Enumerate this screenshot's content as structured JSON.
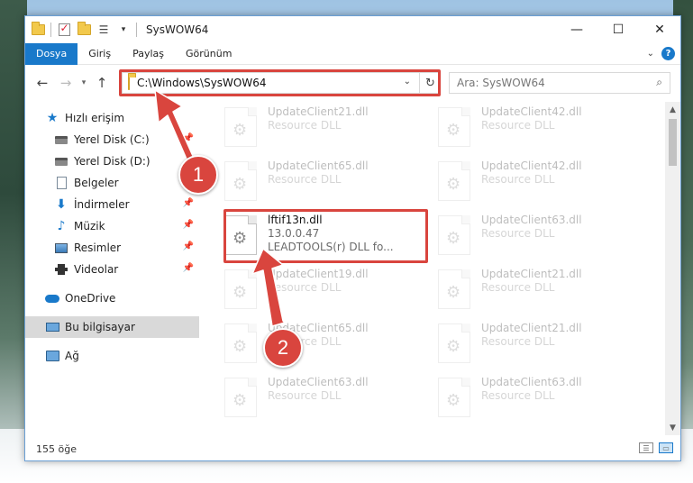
{
  "window": {
    "title": "SysWOW64",
    "controls": {
      "minimize": "—",
      "maximize": "☐",
      "close": "✕"
    }
  },
  "ribbon": {
    "tabs": [
      "Dosya",
      "Giriş",
      "Paylaş",
      "Görünüm"
    ],
    "help": "?"
  },
  "address": {
    "path": "C:\\Windows\\SysWOW64",
    "search_placeholder": "Ara: SysWOW64"
  },
  "nav": {
    "quick_access": "Hızlı erişim",
    "pinned": [
      "Yerel Disk (C:)",
      "Yerel Disk (D:)",
      "Belgeler",
      "İndirmeler",
      "Müzik",
      "Resimler",
      "Videolar"
    ],
    "onedrive": "OneDrive",
    "this_pc": "Bu bilgisayar",
    "network": "Ağ"
  },
  "files": [
    {
      "name": "UpdateClient21.dll",
      "desc": "Resource DLL"
    },
    {
      "name": "UpdateClient42.dll",
      "desc": "Resource DLL"
    },
    {
      "name": "UpdateClient65.dll",
      "desc": "Resource DLL"
    },
    {
      "name": "UpdateClient42.dll",
      "desc": "Resource DLL"
    },
    {
      "name": "lftif13n.dll",
      "version": "13.0.0.47",
      "desc": "LEADTOOLS(r) DLL fo..."
    },
    {
      "name": "UpdateClient63.dll",
      "desc": "Resource DLL"
    },
    {
      "name": "UpdateClient19.dll",
      "desc": "Resource DLL"
    },
    {
      "name": "UpdateClient21.dll",
      "desc": "Resource DLL"
    },
    {
      "name": "UpdateClient65.dll",
      "desc": "Resource DLL"
    },
    {
      "name": "UpdateClient21.dll",
      "desc": "Resource DLL"
    },
    {
      "name": "UpdateClient63.dll",
      "desc": "Resource DLL"
    },
    {
      "name": "UpdateClient63.dll",
      "desc": "Resource DLL"
    }
  ],
  "status": {
    "count": "155 öğe"
  },
  "callouts": [
    "1",
    "2"
  ],
  "colors": {
    "accent": "#1979ca",
    "highlight": "#d9453e"
  }
}
